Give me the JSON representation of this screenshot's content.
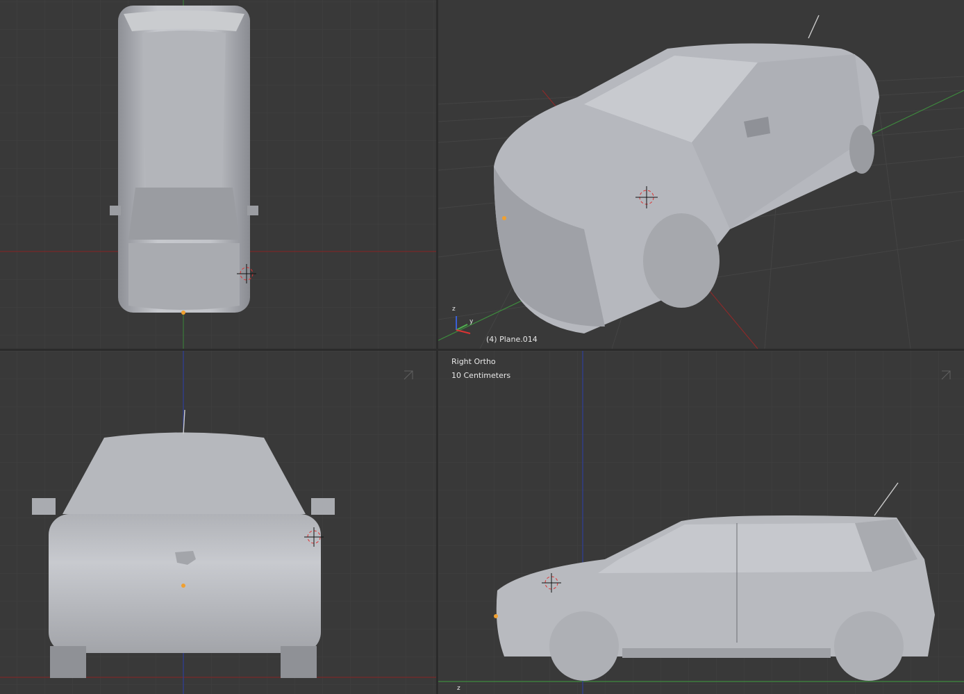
{
  "viewports": {
    "top": {
      "corner_icon": "split-corner-icon"
    },
    "perspective": {
      "object_label": "(4) Plane.014",
      "corner_icon": "split-corner-icon",
      "axis_labels": {
        "z": "z",
        "y": "y"
      }
    },
    "front": {
      "corner_icon": "split-corner-icon"
    },
    "right": {
      "view_name": "Right Ortho",
      "scale": "10 Centimeters",
      "corner_icon": "split-corner-icon",
      "axis_label": "z"
    }
  },
  "colors": {
    "background": "#393939",
    "grid": "#3f3f3f",
    "x_axis": "#8b2a2a",
    "y_axis": "#3e8a3e",
    "z_axis": "#2f3f9a",
    "model": "#b9bcc2",
    "origin_dot": "#f0a030"
  }
}
